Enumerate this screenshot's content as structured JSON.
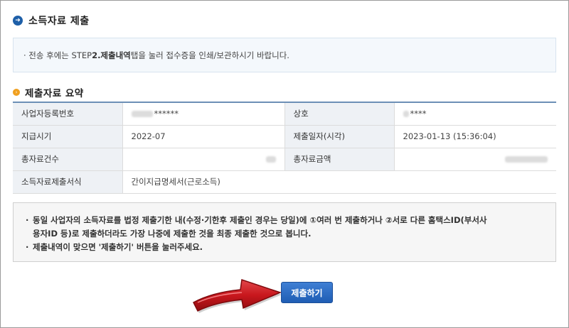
{
  "section": {
    "title": "소득자료 제출",
    "icon": "arrow-right-circle-icon"
  },
  "notice_top": {
    "prefix": "· 전송 후에는 STEP ",
    "bold": "2.제출내역",
    "suffix": " 탭을 눌러 접수증을 인쇄/보관하시기 바랍니다."
  },
  "summary": {
    "title": "제출자료 요약",
    "icon": "orange-bullet-icon",
    "rows": [
      {
        "label1": "사업자등록번호",
        "value1": "******",
        "label2": "상호",
        "value2": "****"
      },
      {
        "label1": "지급시기",
        "value1": "2022-07",
        "label2": "제출일자(시각)",
        "value2": "2023-01-13 (15:36:04)"
      },
      {
        "label1": "총자료건수",
        "value1": "",
        "label2": "총자료금액",
        "value2": ""
      },
      {
        "label1": "소득자료제출서식",
        "value1": "간이지급명세서(근로소득)"
      }
    ]
  },
  "notice_box": {
    "line1": "동일 사업자의 소득자료를 법정 제출기한 내(수정·기한후 제출인 경우는 당일)에 ①여러 번 제출하거나 ②서로 다른 홈택스ID(부서사",
    "line2": "용자ID 등)로 제출하더라도 가장 나중에 제출한 것을 최종 제출한 것으로 봅니다.",
    "line3": "제출내역이 맞으면 '제출하기' 버튼을 눌러주세요."
  },
  "submit_button": {
    "label": "제출하기"
  },
  "colors": {
    "accent_blue": "#1f5db4",
    "bullet_orange": "#f0a020",
    "arrow_red": "#c8171d"
  }
}
